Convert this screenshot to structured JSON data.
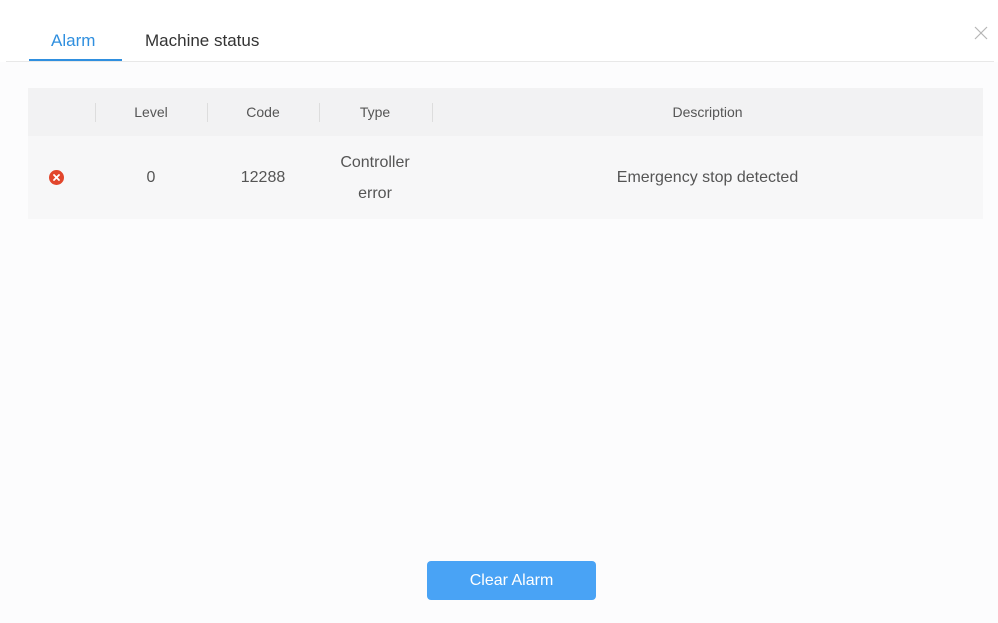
{
  "tabs": [
    {
      "label": "Alarm",
      "active": true
    },
    {
      "label": "Machine status",
      "active": false
    }
  ],
  "close_icon": "close-icon",
  "table": {
    "columns": [
      "Level",
      "Code",
      "Type",
      "Description"
    ],
    "rows": [
      {
        "status_icon": "error-circle-icon",
        "level": "0",
        "code": "12288",
        "type_line1": "Controller",
        "type_line2": "error",
        "description": "Emergency stop detected"
      }
    ]
  },
  "footer": {
    "clear_label": "Clear Alarm"
  },
  "colors": {
    "accent": "#2f8fdf",
    "button": "#49a3f5",
    "error": "#e2462c"
  }
}
